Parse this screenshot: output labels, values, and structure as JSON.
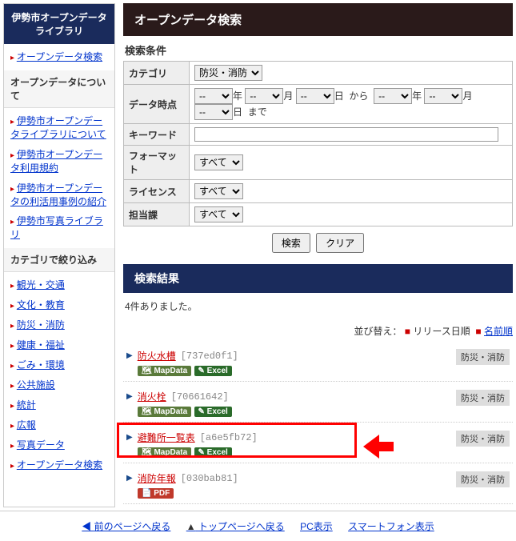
{
  "sidebar": {
    "header": "伊勢市オープンデータライブラリ",
    "top_link": "オープンデータ検索",
    "sec_about": "オープンデータについて",
    "about_items": [
      "伊勢市オープンデータライブラリについて",
      "伊勢市オープンデータ利用規約",
      "伊勢市オープンデータの利活用事例の紹介",
      "伊勢市写真ライブラリ"
    ],
    "sec_cat": "カテゴリで絞り込み",
    "cat_items": [
      "観光・交通",
      "文化・教育",
      "防災・消防",
      "健康・福祉",
      "ごみ・環境",
      "公共施設",
      "統計",
      "広報",
      "写真データ",
      "オープンデータ検索"
    ]
  },
  "page_title": "オープンデータ検索",
  "cond": {
    "label": "検索条件",
    "rows": {
      "category": "カテゴリ",
      "date": "データ時点",
      "keyword": "キーワード",
      "format": "フォーマット",
      "license": "ライセンス",
      "department": "担当課"
    },
    "cat_value": "防災・消防",
    "dash": "--",
    "y": "年",
    "m": "月",
    "d": "日",
    "from": "から",
    "to": "まで",
    "all": "すべて",
    "search_btn": "検索",
    "clear_btn": "クリア"
  },
  "results": {
    "title": "検索結果",
    "count": "4件ありました。",
    "sort_label": "並び替え：",
    "sort_release": "リリース日順",
    "sort_name": "名前順",
    "items": [
      {
        "title": "防火水槽",
        "hash": "[737ed0f1]",
        "tag": "防災・消防",
        "badges": [
          "map",
          "excel"
        ]
      },
      {
        "title": "消火栓",
        "hash": "[70661642]",
        "tag": "防災・消防",
        "badges": [
          "map",
          "excel"
        ]
      },
      {
        "title": "避難所一覧表",
        "hash": "[a6e5fb72]",
        "tag": "防災・消防",
        "badges": [
          "map",
          "excel"
        ],
        "highlight": true
      },
      {
        "title": "消防年報",
        "hash": "[030bab81]",
        "tag": "防災・消防",
        "badges": [
          "pdf"
        ]
      }
    ],
    "badge_labels": {
      "map": "MapData",
      "excel": "Excel",
      "pdf": "PDF"
    }
  },
  "footer": {
    "back": "前のページへ戻る",
    "top": "トップページへ戻る",
    "pc": "PC表示",
    "sp": "スマートフォン表示"
  }
}
